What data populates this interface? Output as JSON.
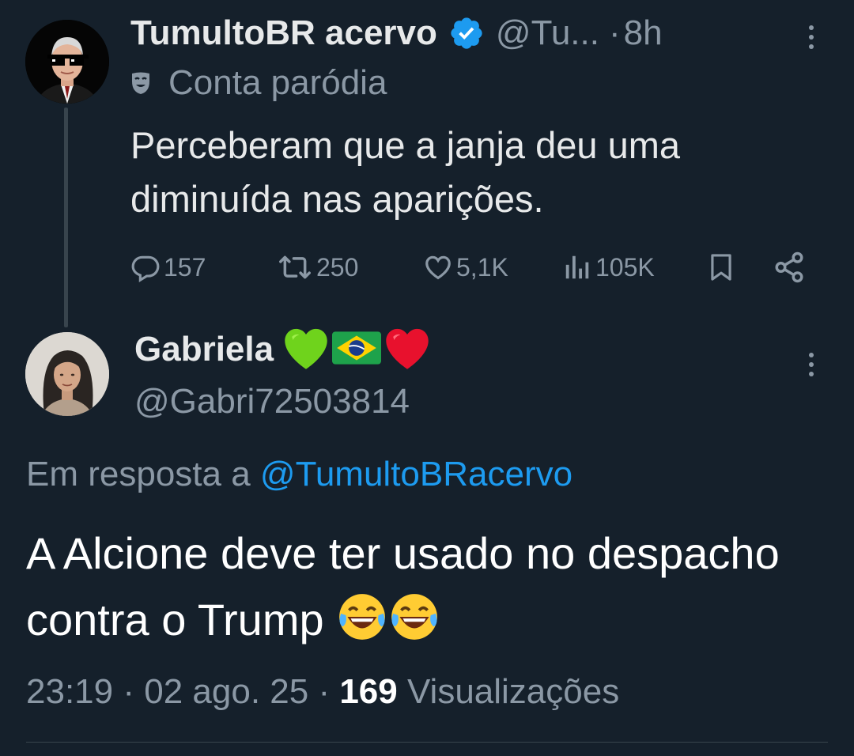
{
  "parent_tweet": {
    "display_name": "TumultoBR acervo",
    "handle": "@Tu...",
    "separator": "·",
    "time": "8h",
    "parody_label": "Conta paródia",
    "text": "Perceberam que a janja deu uma diminuída nas aparições.",
    "actions": {
      "replies": "157",
      "reposts": "250",
      "likes": "5,1K",
      "views": "105K"
    }
  },
  "reply_tweet": {
    "display_name": "Gabriela",
    "name_emojis": [
      "green-heart",
      "brazil-flag",
      "red-heart"
    ],
    "handle": "@Gabri72503814",
    "in_reply_prefix": "Em resposta a",
    "in_reply_mention": "@TumultoBRacervo",
    "text": "A Alcione deve ter usado no despacho contra o Trump",
    "text_emojis": [
      "laughing-tears",
      "laughing-tears"
    ],
    "time": "23:19",
    "date": "02 ago. 25",
    "separator": "·",
    "view_count": "169",
    "view_label": "Visualizações"
  },
  "colors": {
    "background": "#15202b",
    "primary_text": "#e7e9ea",
    "secondary_text": "#8b98a5",
    "link": "#1d9bf0",
    "verified": "#1d9bf0",
    "divider": "#38444d"
  }
}
